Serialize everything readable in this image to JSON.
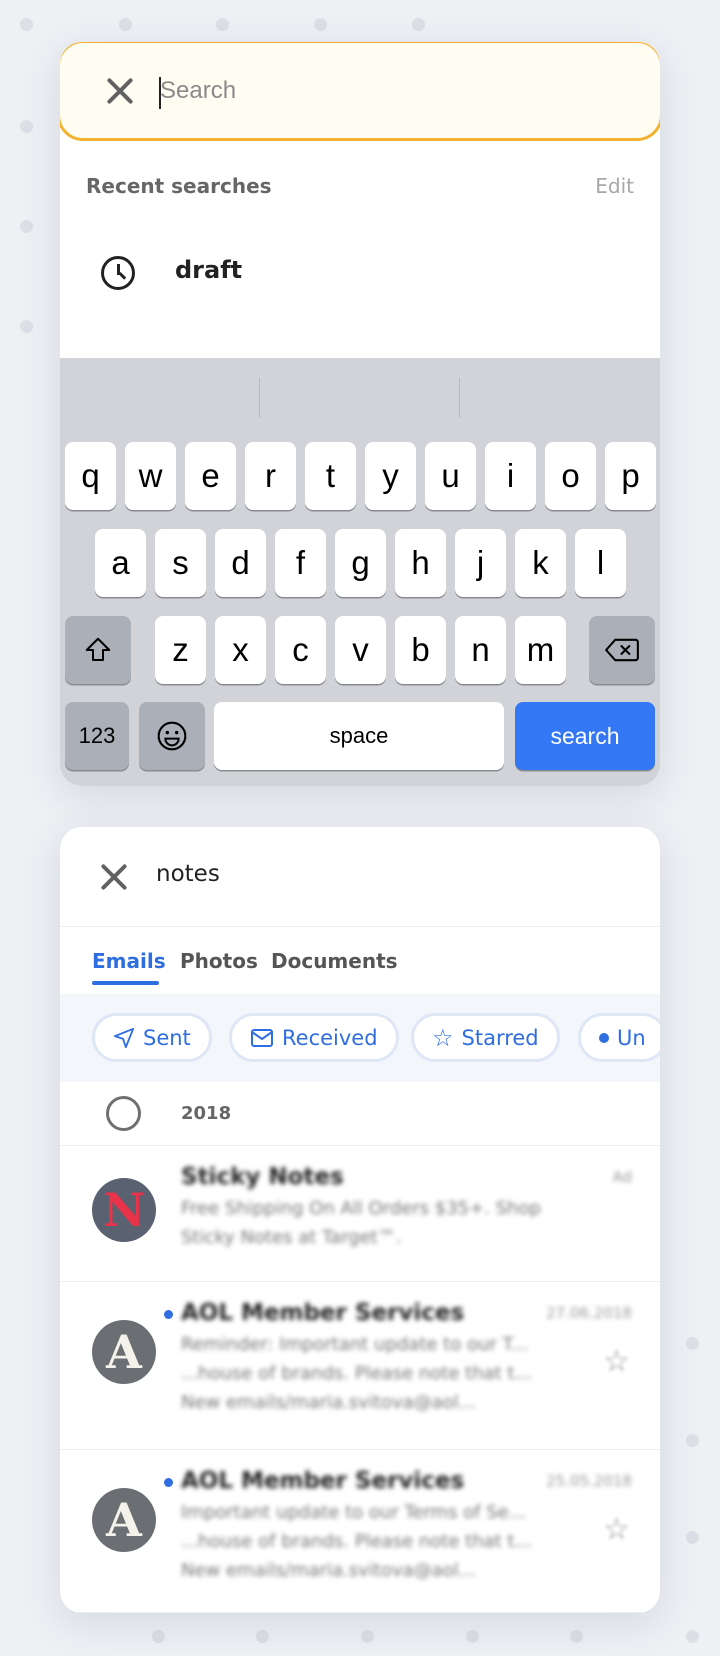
{
  "search_panel": {
    "placeholder": "Search",
    "recent_label": "Recent searches",
    "edit_label": "Edit",
    "recent_items": [
      "draft"
    ]
  },
  "keyboard": {
    "row1": [
      "q",
      "w",
      "e",
      "r",
      "t",
      "y",
      "u",
      "i",
      "o",
      "p"
    ],
    "row2": [
      "a",
      "s",
      "d",
      "f",
      "g",
      "h",
      "j",
      "k",
      "l"
    ],
    "row3": [
      "z",
      "x",
      "c",
      "v",
      "b",
      "n",
      "m"
    ],
    "numbers_label": "123",
    "space_label": "space",
    "search_label": "search",
    "accent": "#3478f6"
  },
  "results_panel": {
    "query": "notes",
    "tabs": [
      "Emails",
      "Photos",
      "Documents"
    ],
    "active_tab": "Emails",
    "filters": [
      "Sent",
      "Received",
      "Starred",
      "Un"
    ],
    "year": "2018",
    "emails": [
      {
        "sender": "Sticky Notes",
        "date": "Ad",
        "lines": [
          "Free Shipping On All Orders $35+. Shop",
          "Sticky Notes at Target™."
        ],
        "avatar": "N",
        "unread": false
      },
      {
        "sender": "AOL Member Services",
        "date": "27.06.2018",
        "lines": [
          "Reminder: Important update to our T...",
          "...house of brands. Please note that t...",
          "New emails/maria.svitova@aol..."
        ],
        "avatar": "A",
        "unread": true
      },
      {
        "sender": "AOL Member Services",
        "date": "25.05.2018",
        "lines": [
          "Important update to our Terms of Se...",
          "...house of brands. Please note that t...",
          "New emails/maria.svitova@aol..."
        ],
        "avatar": "A",
        "unread": true
      }
    ]
  },
  "colors": {
    "focus_border": "#f3b32f",
    "link_blue": "#2f6ee0"
  }
}
